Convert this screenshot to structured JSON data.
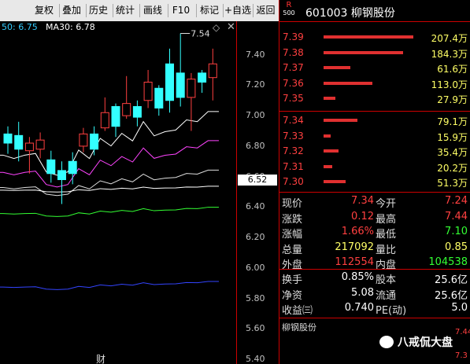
{
  "toolbar": {
    "items": [
      "复权",
      "叠加",
      "历史",
      "统计",
      "画线",
      "F10",
      "标记",
      "+自选",
      "返回"
    ]
  },
  "chart": {
    "ma_labels": [
      {
        "text": "50: 6.75",
        "color": "#33ccff"
      },
      {
        "text": "MA30: 6.78",
        "color": "#ffffff"
      }
    ],
    "high_annotation": "7.54",
    "y_ticks": [
      "7.40",
      "7.20",
      "7.00",
      "6.80",
      "6.60",
      "6.40",
      "6.20",
      "6.00",
      "5.80",
      "5.60",
      "5.40"
    ],
    "y_range": [
      5.37,
      7.62
    ],
    "current_price_flag": "6.52",
    "bottom_char": "财",
    "candles": [
      {
        "o": 6.88,
        "c": 6.82,
        "h": 6.93,
        "l": 6.75
      },
      {
        "o": 6.87,
        "c": 6.78,
        "h": 6.96,
        "l": 6.7
      },
      {
        "o": 6.77,
        "c": 6.82,
        "h": 6.86,
        "l": 6.62
      },
      {
        "o": 6.78,
        "c": 6.84,
        "h": 6.89,
        "l": 6.72
      },
      {
        "o": 6.71,
        "c": 6.62,
        "h": 6.77,
        "l": 6.56
      },
      {
        "o": 6.64,
        "c": 6.58,
        "h": 6.7,
        "l": 6.42
      },
      {
        "o": 6.7,
        "c": 6.62,
        "h": 6.76,
        "l": 6.55
      },
      {
        "o": 6.8,
        "c": 6.88,
        "h": 6.92,
        "l": 6.76
      },
      {
        "o": 6.88,
        "c": 6.78,
        "h": 6.93,
        "l": 6.74
      },
      {
        "o": 6.92,
        "c": 7.02,
        "h": 7.12,
        "l": 6.9
      },
      {
        "o": 7.06,
        "c": 6.93,
        "h": 7.08,
        "l": 6.86
      },
      {
        "o": 7.0,
        "c": 7.08,
        "h": 7.26,
        "l": 6.98
      },
      {
        "o": 7.06,
        "c": 6.99,
        "h": 7.1,
        "l": 6.93
      },
      {
        "o": 7.1,
        "c": 7.22,
        "h": 7.3,
        "l": 7.05
      },
      {
        "o": 7.18,
        "c": 7.05,
        "h": 7.2,
        "l": 7.0
      },
      {
        "o": 7.34,
        "c": 7.1,
        "h": 7.44,
        "l": 7.02
      },
      {
        "o": 7.28,
        "c": 7.12,
        "h": 7.54,
        "l": 7.06
      },
      {
        "o": 7.12,
        "c": 7.24,
        "h": 7.28,
        "l": 6.9
      },
      {
        "o": 7.28,
        "c": 7.22,
        "h": 7.3,
        "l": 7.15
      },
      {
        "o": 7.25,
        "c": 7.34,
        "h": 7.44,
        "l": 7.1
      }
    ]
  },
  "panel": {
    "badge_top": "R",
    "badge_bottom": "500",
    "code_title": "601003 柳钢股份",
    "asks": [
      {
        "price": "7.39",
        "vol": "207.4万",
        "v": 207.4
      },
      {
        "price": "7.38",
        "vol": "184.3万",
        "v": 184.3
      },
      {
        "price": "7.37",
        "vol": "61.6万",
        "v": 61.6
      },
      {
        "price": "7.36",
        "vol": "113.0万",
        "v": 113.0
      },
      {
        "price": "7.35",
        "vol": "27.9万",
        "v": 27.9
      }
    ],
    "bids": [
      {
        "price": "7.34",
        "vol": "79.1万",
        "v": 79.1
      },
      {
        "price": "7.33",
        "vol": "15.9万",
        "v": 15.9
      },
      {
        "price": "7.32",
        "vol": "35.4万",
        "v": 35.4
      },
      {
        "price": "7.31",
        "vol": "20.2万",
        "v": 20.2
      },
      {
        "price": "7.30",
        "vol": "51.3万",
        "v": 51.3
      }
    ],
    "stats": [
      {
        "l1": "现价",
        "v1": "7.34",
        "c1": "red",
        "l2": "今开",
        "v2": "7.24",
        "c2": "red"
      },
      {
        "l1": "涨跌",
        "v1": "0.12",
        "c1": "red",
        "l2": "最高",
        "v2": "7.44",
        "c2": "red"
      },
      {
        "l1": "涨幅",
        "v1": "1.66%",
        "c1": "red",
        "l2": "最低",
        "v2": "7.10",
        "c2": "green"
      },
      {
        "l1": "总量",
        "v1": "217092",
        "c1": "yellow",
        "l2": "量比",
        "v2": "0.85",
        "c2": "yellow"
      },
      {
        "l1": "外盘",
        "v1": "112554",
        "c1": "red",
        "l2": "内盘",
        "v2": "104538",
        "c2": "green"
      }
    ],
    "stats2": [
      {
        "l1": "换手",
        "v1": "0.85%",
        "l2": "股本",
        "v2": "25.6亿"
      },
      {
        "l1": "净资",
        "v1": "5.08",
        "l2": "流通",
        "v2": "25.6亿"
      },
      {
        "l1": "收益㈢",
        "v1": "0.740",
        "l2": "PE(动)",
        "v2": "5.0"
      }
    ],
    "mini_title": "柳钢股份",
    "mini_price_top": "7.44",
    "mini_price_bottom": "7.3",
    "watermark": "八戒侃大盘"
  }
}
